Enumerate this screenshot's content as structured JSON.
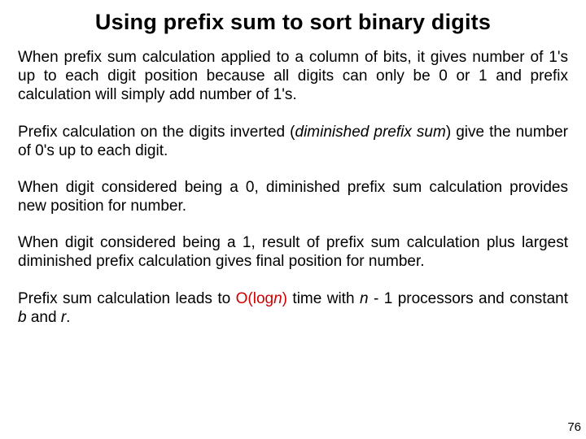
{
  "title": "Using prefix sum to sort binary digits",
  "p1": "When prefix sum calculation applied to a column of bits, it gives number of 1's up to each digit position because all digits can only be 0 or 1 and prefix calculation will simply add number of 1's.",
  "p2_a": "Prefix calculation on the digits inverted (",
  "p2_b": "diminished prefix sum",
  "p2_c": ") give the number of 0's up to each digit.",
  "p3": "When digit considered being a 0, diminished prefix sum calculation provides new position for number.",
  "p4": "When digit considered being a 1, result of prefix sum calculation plus largest diminished prefix calculation gives final position for number.",
  "p5_a": "Prefix sum calculation leads to ",
  "p5_b": "O(log",
  "p5_c": "n",
  "p5_d": ")",
  "p5_e": " time with ",
  "p5_f": "n",
  "p5_g": " - 1 processors and constant ",
  "p5_h": "b",
  "p5_i": " and ",
  "p5_j": "r",
  "p5_k": ".",
  "pagenum": "76"
}
